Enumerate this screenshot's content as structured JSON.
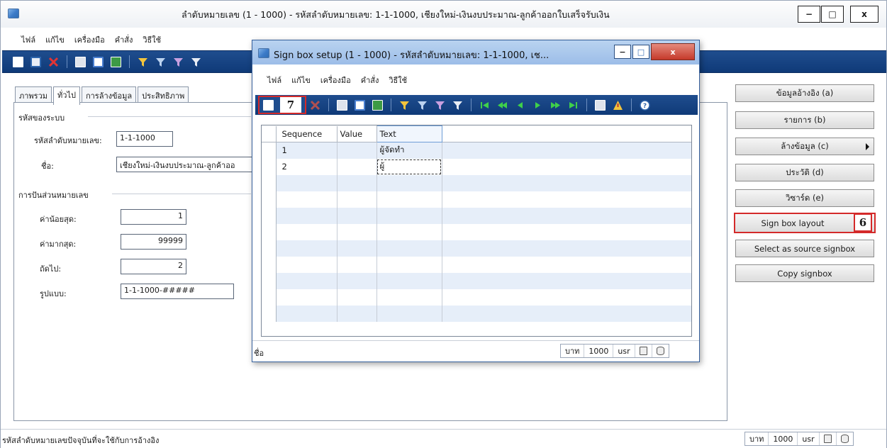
{
  "main": {
    "title": "ลำดับหมายเลข (1 - 1000) - รหัสลำดับหมายเลข: 1-1-1000, เชียงใหม่-เงินงบประมาณ-ลูกค้าออกใบเสร็จรับเงิน",
    "window_buttons": {
      "minimize": "−",
      "maximize": "□",
      "close": "x"
    },
    "menu": [
      "ไฟล์",
      "แก้ไข",
      "เครื่องมือ",
      "คำสั่ง",
      "วิธีใช้"
    ],
    "tabs": [
      "ภาพรวม",
      "ทั่วไป",
      "การล้างข้อมูล",
      "ประสิทธิภาพ"
    ],
    "groups": {
      "system_code": {
        "header": "รหัสของระบบ",
        "number_seq_label": "รหัสลำดับหมายเลข:",
        "number_seq_value": "1-1-1000",
        "name_label": "ชื่อ:",
        "name_value": "เชียงใหม่-เงินงบประมาณ-ลูกค้าออ"
      },
      "segments": {
        "header": "การปันส่วนหมายเลข",
        "min_label": "ค่าน้อยสุด:",
        "min_value": "1",
        "max_label": "ค่ามากสุด:",
        "max_value": "99999",
        "next_label": "ถัดไป:",
        "next_value": "2",
        "format_label": "รูปแบบ:",
        "format_value": "1-1-1000-#####"
      }
    },
    "right_buttons": {
      "references": "ข้อมูลอ้างอิง (a)",
      "list": "รายการ (b)",
      "cleanup": "ล้างข้อมูล (c)",
      "history": "ประวัติ (d)",
      "wizard": "วิซาร์ด (e)",
      "sign_box_layout": "Sign box layout",
      "select_source": "Select as source signbox",
      "copy_signbox": "Copy signbox"
    },
    "status": {
      "text": "รหัสลำดับหมายเลขปัจจุบันที่จะใช้กับการอ้างอิง",
      "currency": "บาท",
      "company": "1000",
      "user": "usr"
    }
  },
  "dialog": {
    "title": "Sign box setup (1 - 1000) - รหัสลำดับหมายเลข: 1-1-1000, เช...",
    "menu": [
      "ไฟล์",
      "แก้ไข",
      "เครื่องมือ",
      "คำสั่ง",
      "วิธีใช้"
    ],
    "grid": {
      "columns": [
        "Sequence",
        "Value",
        "Text"
      ],
      "rows": [
        {
          "sequence": "1",
          "value": "",
          "text": "ผู้จัดทำ"
        },
        {
          "sequence": "2",
          "value": "",
          "text": "ผู้"
        }
      ]
    },
    "status": {
      "text": "ชื่อ",
      "currency": "บาท",
      "company": "1000",
      "user": "usr"
    }
  },
  "annotations": {
    "badge_6": "6",
    "badge_7": "7"
  },
  "colors": {
    "accent_red": "#d42a2a",
    "toolbar_blue": "#1f4d8e",
    "row_alt": "#e6eef9"
  },
  "icons": {
    "toolbar_main": [
      "new-icon",
      "save-icon",
      "delete-icon",
      "print-icon",
      "print-preview-icon",
      "excel-icon",
      "filter-by-selection-icon",
      "filter-icon",
      "advanced-filter-icon",
      "funnel-icon"
    ],
    "toolbar_dialog": [
      "new-icon",
      "delete-icon",
      "print-icon",
      "print-preview-icon",
      "excel-icon",
      "filter-by-selection-icon",
      "filter-icon",
      "advanced-filter-icon",
      "funnel-icon",
      "first-record-icon",
      "previous-page-icon",
      "previous-record-icon",
      "next-record-icon",
      "next-page-icon",
      "last-record-icon",
      "document-handling-icon",
      "alert-icon",
      "help-icon"
    ]
  }
}
